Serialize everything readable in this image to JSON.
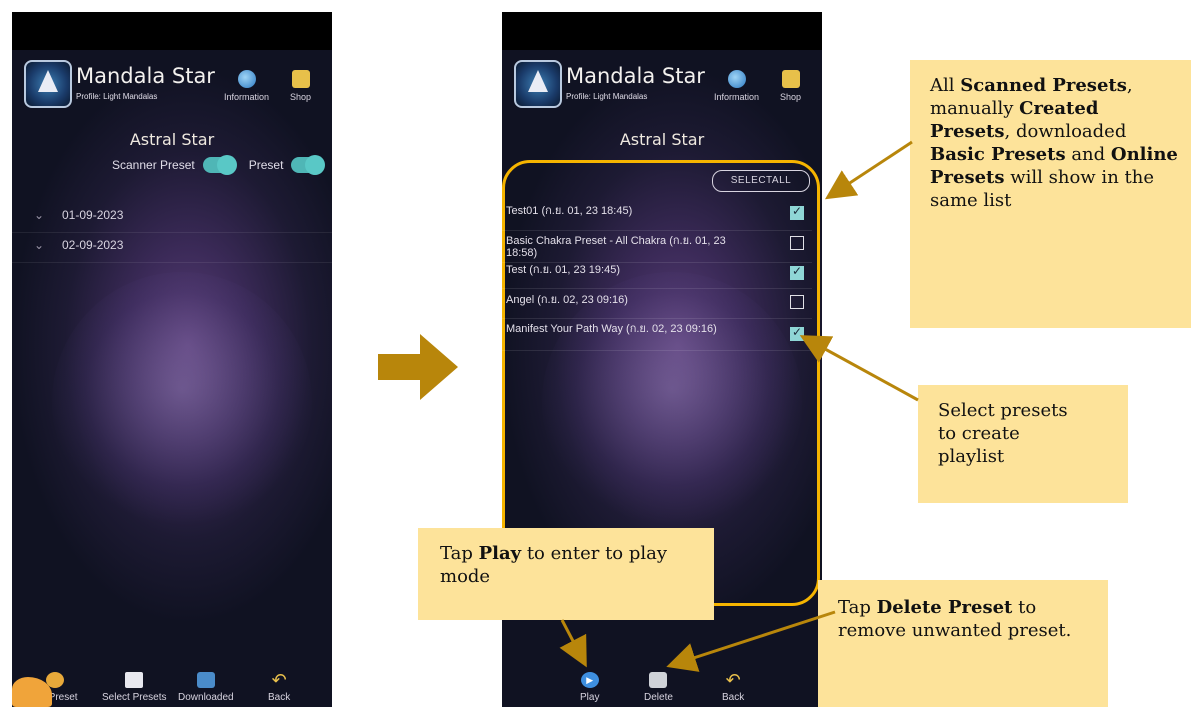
{
  "app": {
    "title": "Mandala Star",
    "profile": "Profile: Light Mandalas",
    "information_label": "Information",
    "shop_label": "Shop",
    "page_title": "Astral Star"
  },
  "left_screen": {
    "toggles": {
      "scanner_preset": "Scanner Preset",
      "preset": "Preset"
    },
    "dates": [
      "01-09-2023",
      "02-09-2023"
    ],
    "bottom_bar": {
      "create": "ate Preset",
      "select": "Select Presets",
      "downloaded": "Downloaded",
      "back": "Back"
    }
  },
  "right_screen": {
    "select_all": "SELECTALL",
    "presets": [
      {
        "name": "Test01 (ก.ย. 01, 23 18:45)",
        "checked": true
      },
      {
        "name": "Basic Chakra Preset - All Chakra (ก.ย. 01, 23 18:58)",
        "checked": false
      },
      {
        "name": "Test  (ก.ย. 01, 23 19:45)",
        "checked": true
      },
      {
        "name": "Angel (ก.ย. 02, 23 09:16)",
        "checked": false
      },
      {
        "name": "Manifest Your Path Way (ก.ย. 02, 23 09:16)",
        "checked": true
      }
    ],
    "bottom_bar": {
      "play": "Play",
      "delete": "Delete",
      "back": "Back"
    }
  },
  "notes": {
    "all_presets": {
      "p1": "All ",
      "b1": "Scanned Presets",
      "p2": ", manually ",
      "b2": "Created Presets",
      "p3": ", downloaded ",
      "b3": "Basic Presets",
      "p4": " and ",
      "b4": "Online Presets",
      "p5": " will show in the same list"
    },
    "select": "Select presets to create playlist",
    "play": {
      "p1": "Tap ",
      "b1": "Play",
      "p2": " to enter to play mode"
    },
    "delete": {
      "p1": "Tap ",
      "b1": "Delete Preset",
      "p2": " to remove unwanted preset."
    }
  },
  "colors": {
    "accent": "#f5b400",
    "note_bg": "#fde39a",
    "arrow": "#b8860b",
    "toggle": "#59c8c6"
  }
}
